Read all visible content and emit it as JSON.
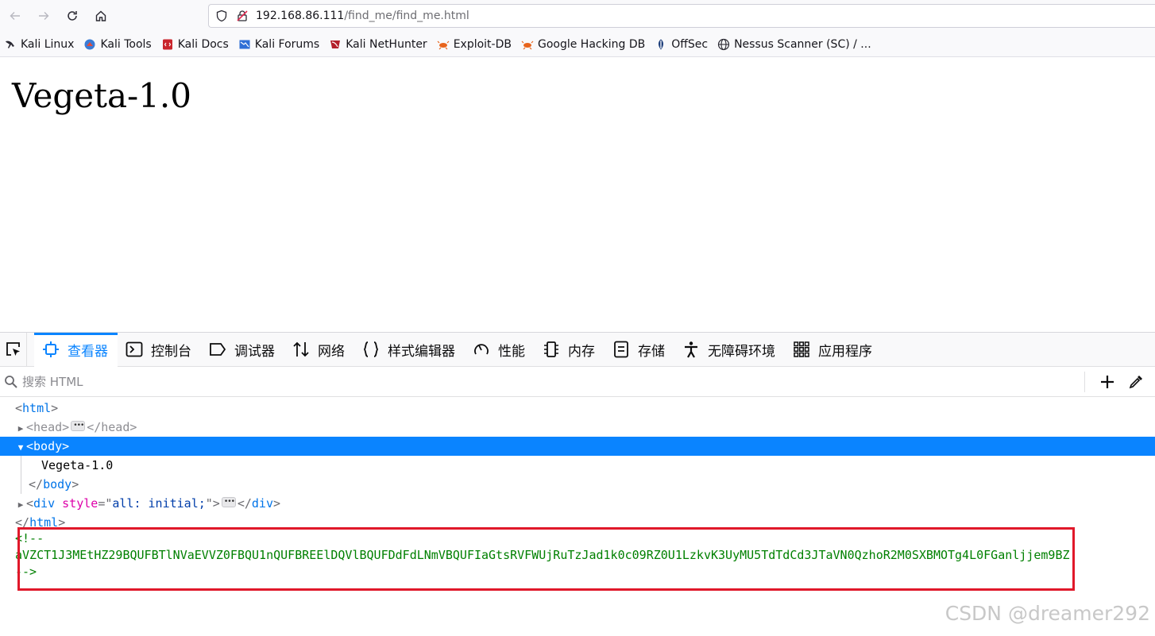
{
  "browser": {
    "url_host": "192.168.86.111",
    "url_path": "/find_me/find_me.html"
  },
  "bookmarks": [
    {
      "label": "Kali Linux",
      "icon": "kali-dragon-icon"
    },
    {
      "label": "Kali Tools",
      "icon": "kali-tools-icon"
    },
    {
      "label": "Kali Docs",
      "icon": "kali-docs-icon"
    },
    {
      "label": "Kali Forums",
      "icon": "kali-forums-icon"
    },
    {
      "label": "Kali NetHunter",
      "icon": "kali-nethunter-icon"
    },
    {
      "label": "Exploit-DB",
      "icon": "exploit-db-icon"
    },
    {
      "label": "Google Hacking DB",
      "icon": "ghdb-icon"
    },
    {
      "label": "OffSec",
      "icon": "offsec-icon"
    },
    {
      "label": "Nessus Scanner (SC) / ...",
      "icon": "globe-icon"
    }
  ],
  "page": {
    "heading": "Vegeta-1.0"
  },
  "devtools": {
    "tabs": [
      {
        "label": "查看器",
        "icon": "inspector-icon",
        "active": true
      },
      {
        "label": "控制台",
        "icon": "console-icon"
      },
      {
        "label": "调试器",
        "icon": "debugger-icon"
      },
      {
        "label": "网络",
        "icon": "network-icon"
      },
      {
        "label": "样式编辑器",
        "icon": "style-editor-icon"
      },
      {
        "label": "性能",
        "icon": "performance-icon"
      },
      {
        "label": "内存",
        "icon": "memory-icon"
      },
      {
        "label": "存储",
        "icon": "storage-icon"
      },
      {
        "label": "无障碍环境",
        "icon": "accessibility-icon"
      },
      {
        "label": "应用程序",
        "icon": "application-icon"
      }
    ],
    "search_placeholder": "搜索 HTML",
    "tree": {
      "html_tag": "html",
      "head_tag": "head",
      "body_tag": "body",
      "body_text": "Vegeta-1.0",
      "div_tag": "div",
      "div_attr_name": "style",
      "div_attr_value": "all: initial;",
      "comment_open": "<!--",
      "comment_body": "aVZCT1J3MEtHZ29BQUFBTlNVaEVVZ0FBQU1nQUFBREElDQVlBQUFDdFdLNmVBQUFIaGtsRVFWUjRuTzJad1k0c09RZ0U1LzkvK3UyMU5TdTdCd3JTaVN0QzhoR2M0SXBMOTg4L0FGanljjem9BZ",
      "comment_close": "-->"
    }
  },
  "watermark": "CSDN @dreamer292"
}
